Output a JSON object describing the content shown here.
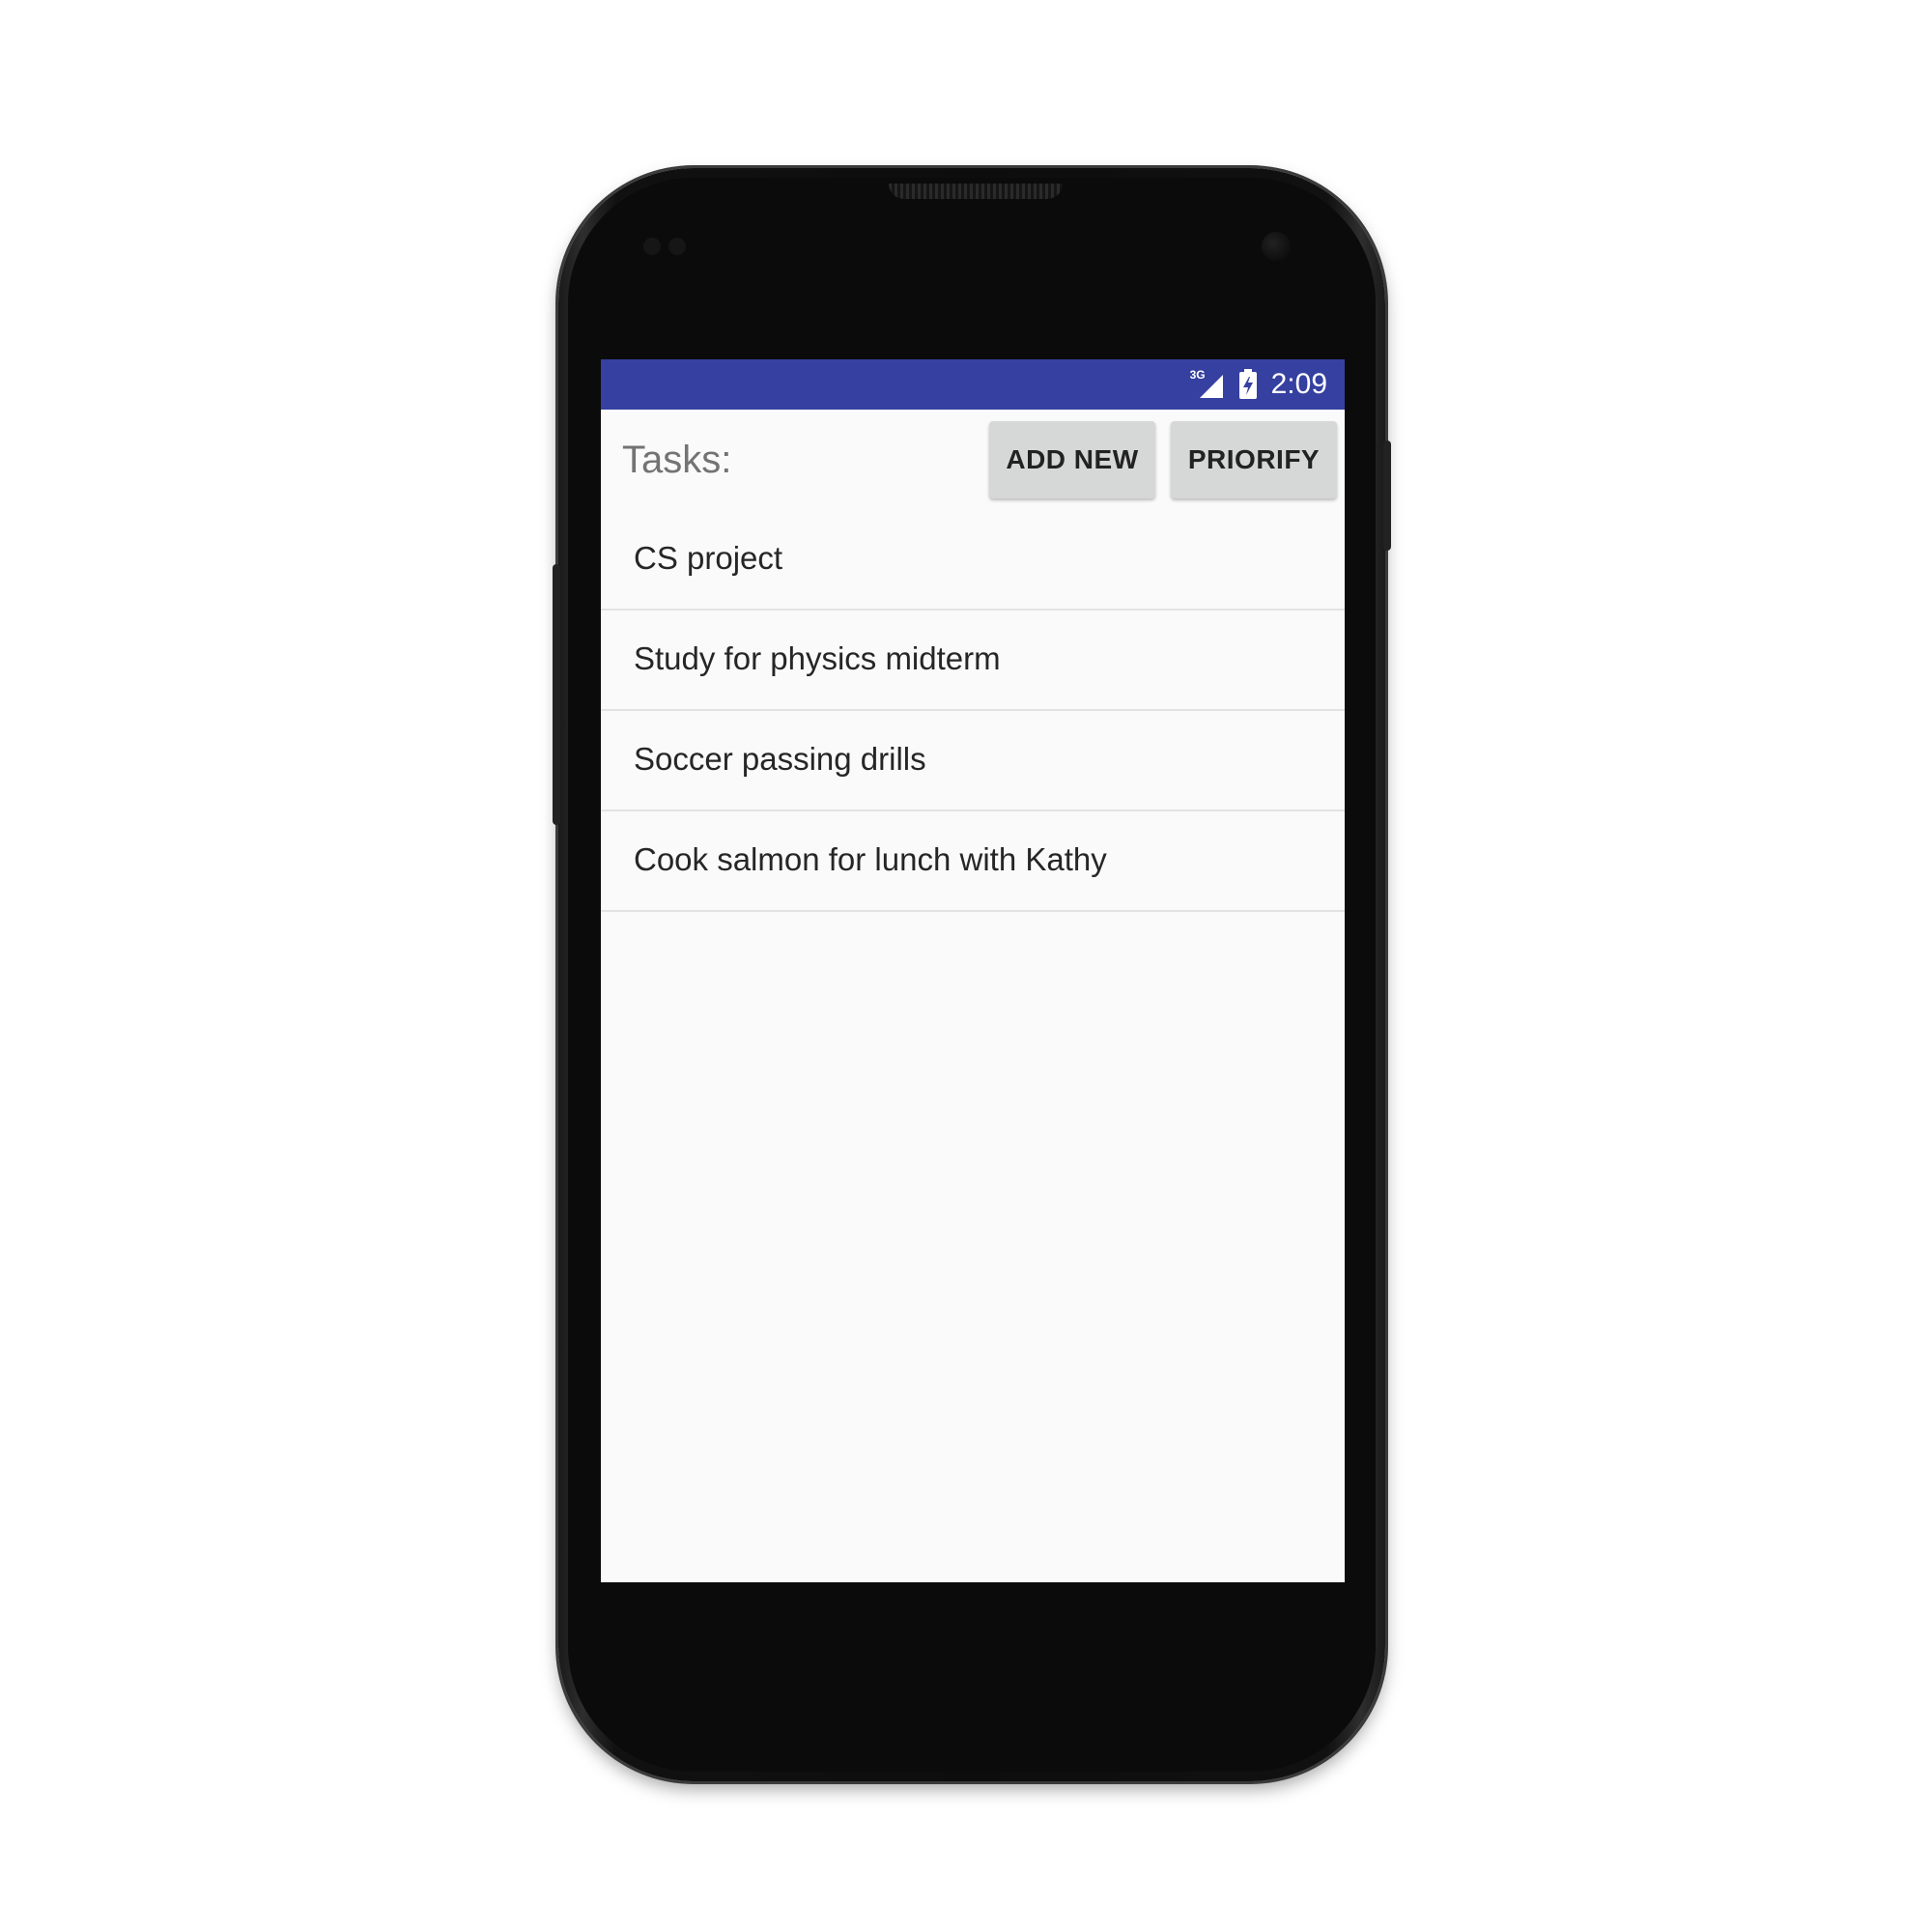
{
  "status_bar": {
    "network_label": "3G",
    "time": "2:09",
    "accent_color": "#3540a0"
  },
  "header": {
    "title": "Tasks:",
    "add_button_label": "ADD NEW",
    "prioritize_button_label": "PRIORIFY"
  },
  "tasks": [
    {
      "label": "CS project"
    },
    {
      "label": "Study for physics midterm"
    },
    {
      "label": "Soccer passing drills"
    },
    {
      "label": "Cook salmon for lunch with Kathy"
    }
  ],
  "icons": {
    "signal": "cell-signal-icon",
    "battery": "battery-charging-icon"
  }
}
